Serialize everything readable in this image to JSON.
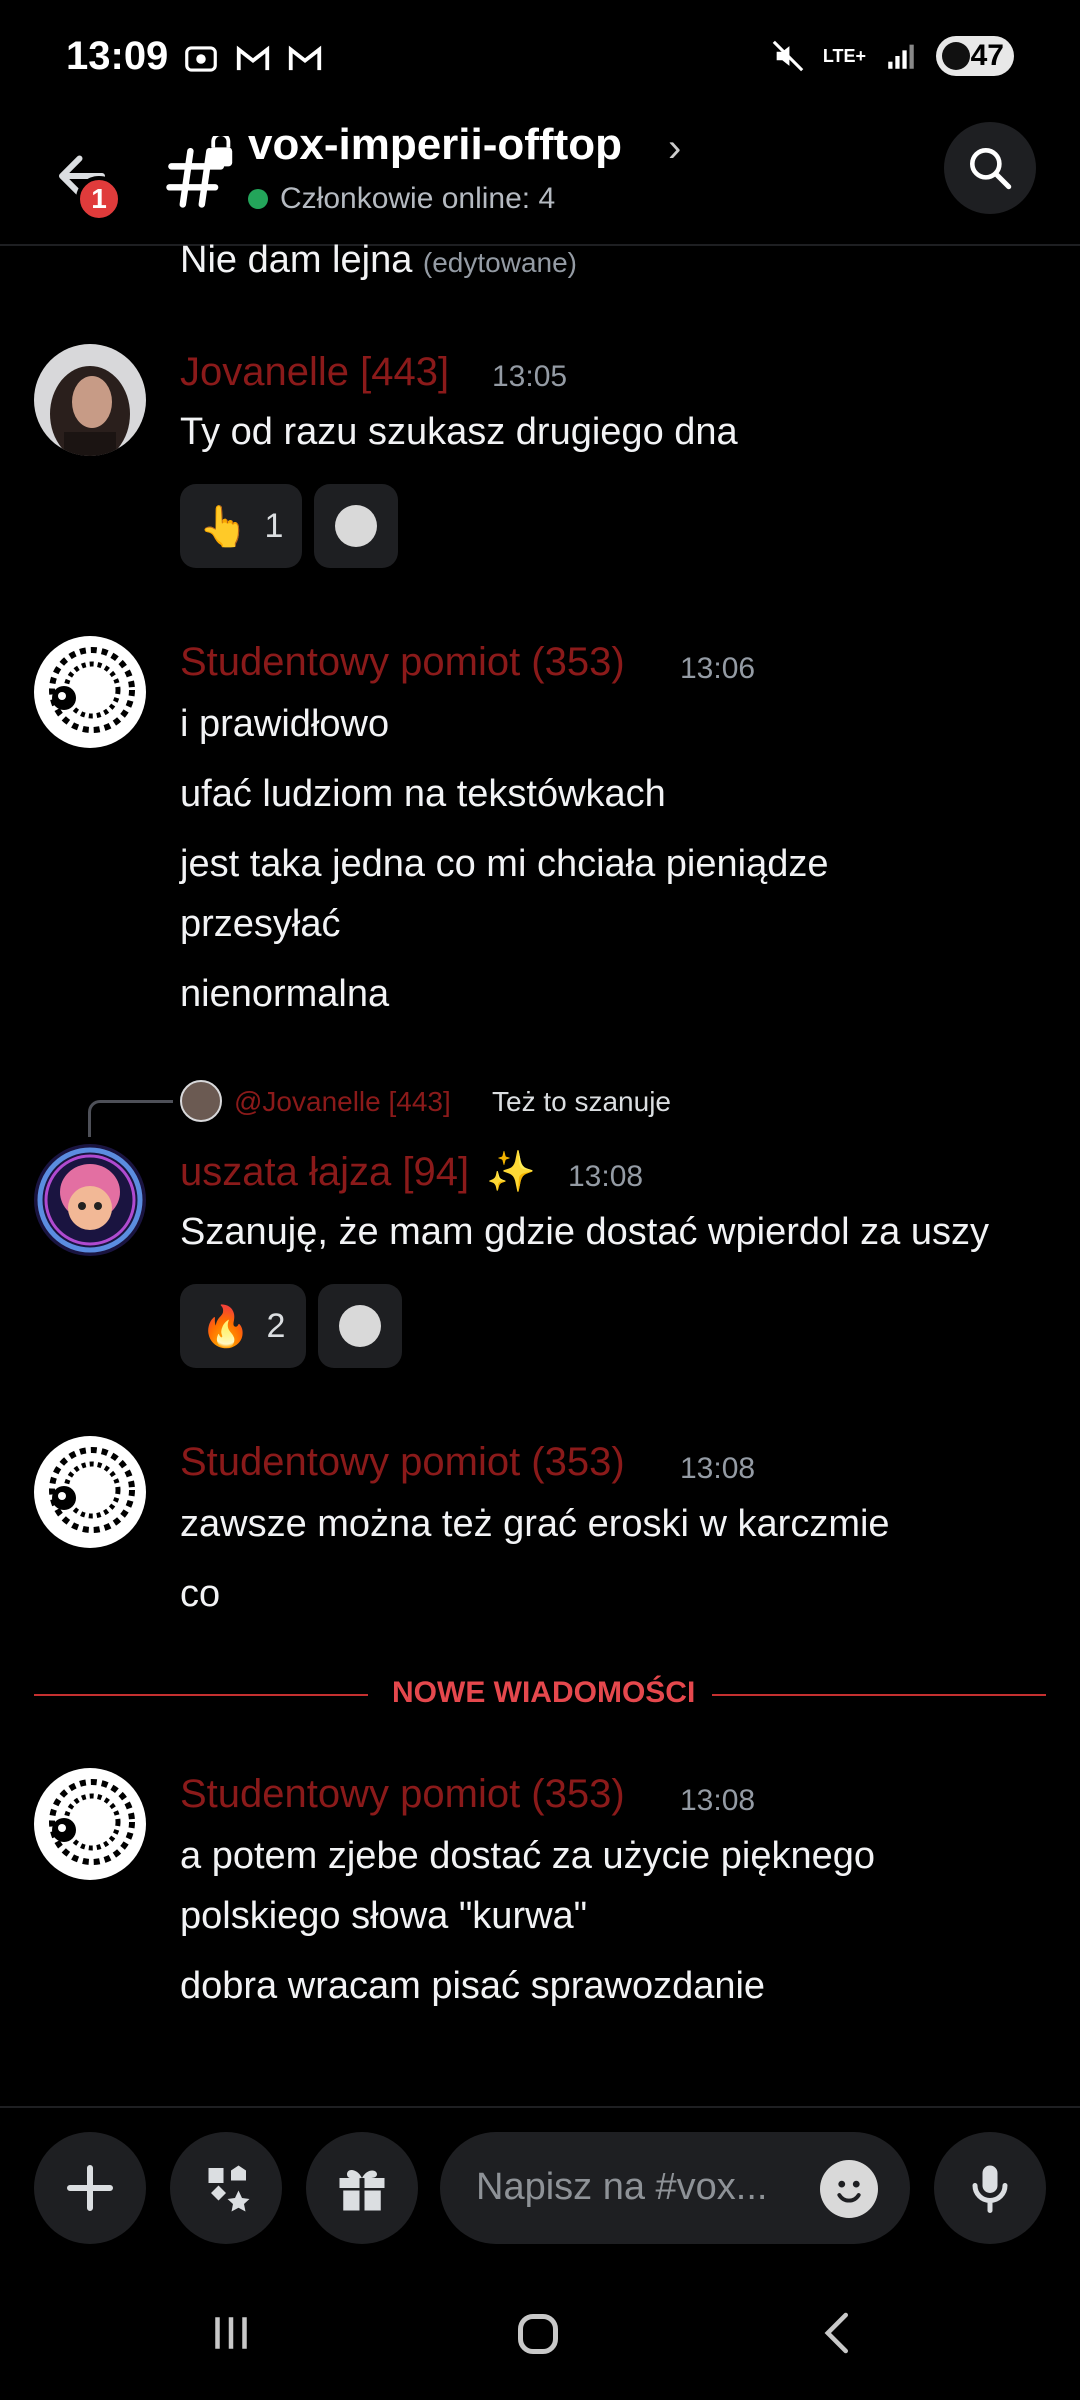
{
  "status_bar": {
    "time": "13:09",
    "network": "LTE+",
    "battery": "47"
  },
  "header": {
    "channel_name": "vox-imperii-offtop",
    "online_text": "Członkowie online: 4",
    "unread_badge": "1"
  },
  "messages": {
    "top_partial": {
      "text": "Nie dam lejna",
      "edited": "(edytowane)"
    },
    "m1": {
      "author": "Jovanelle [443]",
      "time": "13:05",
      "lines": [
        "Ty od razu szukasz drugiego dna"
      ],
      "reaction": {
        "emoji": "👆",
        "count": "1"
      }
    },
    "m2": {
      "author": "Studentowy pomiot (353)",
      "time": "13:06",
      "lines": [
        "i prawidłowo",
        "ufać ludziom na tekstówkach",
        "jest taka jedna co mi chciała pieniądze",
        "przesyłać",
        "nienormalna"
      ]
    },
    "m3": {
      "reply_to": "@Jovanelle [443]",
      "reply_text": "Też to szanuje",
      "author": "uszata łajza [94]",
      "sparkle": "✨",
      "time": "13:08",
      "lines": [
        "Szanuję, że mam gdzie dostać wpierdol za uszy"
      ],
      "reaction": {
        "emoji": "🔥",
        "count": "2"
      }
    },
    "m4": {
      "author": "Studentowy pomiot (353)",
      "time": "13:08",
      "lines": [
        "zawsze można też grać eroski w karczmie",
        "co"
      ]
    },
    "divider": "NOWE WIADOMOŚCI",
    "m5": {
      "author": "Studentowy pomiot (353)",
      "time": "13:08",
      "lines": [
        "a potem zjebe dostać za użycie pięknego",
        "polskiego słowa \"kurwa\"",
        "dobra wracam pisać sprawozdanie"
      ]
    }
  },
  "composer": {
    "placeholder": "Napisz na #vox..."
  },
  "colors": {
    "author_red": "#8b1a1a",
    "new_divider": "#e5484d",
    "online_green": "#23a55a",
    "badge_red": "#e03b3b"
  },
  "icons": [
    "back-arrow-icon",
    "channel-hash-lock-icon",
    "search-icon",
    "plus-icon",
    "apps-icon",
    "gift-icon",
    "emoji-icon",
    "microphone-icon"
  ]
}
